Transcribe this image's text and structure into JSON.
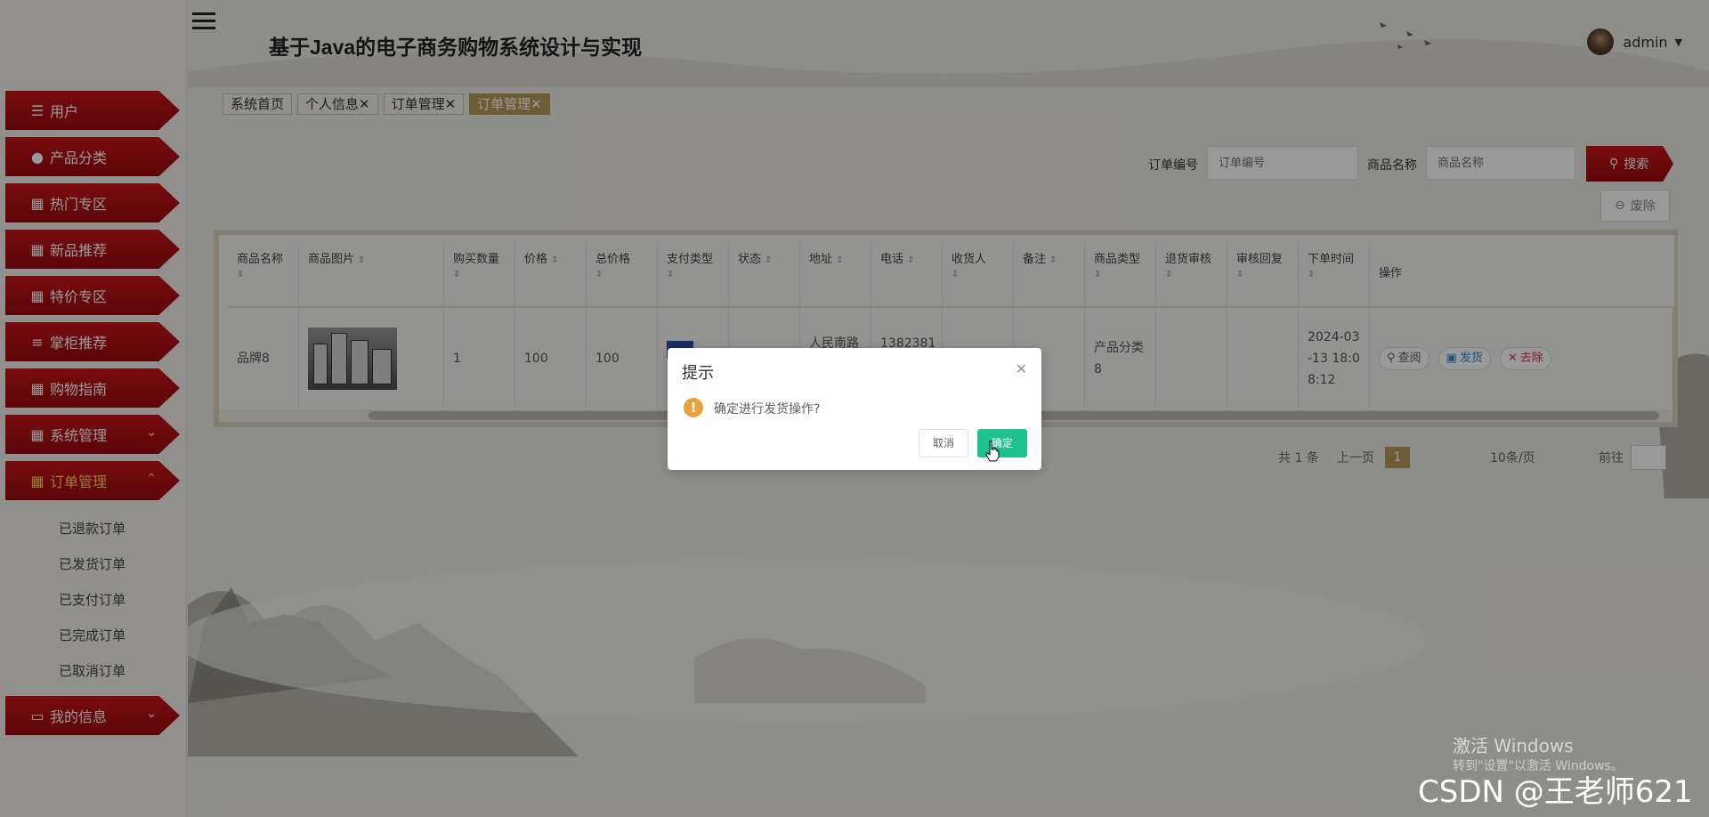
{
  "header": {
    "title": "基于Java的电子商务购物系统设计与实现",
    "user_name": "admin"
  },
  "sidebar": {
    "items": [
      {
        "label": "用户",
        "icon": "sliders-icon"
      },
      {
        "label": "产品分类",
        "icon": "person-icon"
      },
      {
        "label": "热门专区",
        "icon": "grid-icon"
      },
      {
        "label": "新品推荐",
        "icon": "grid-icon"
      },
      {
        "label": "特价专区",
        "icon": "grid-icon"
      },
      {
        "label": "掌柜推荐",
        "icon": "list-icon"
      },
      {
        "label": "购物指南",
        "icon": "grid-icon"
      },
      {
        "label": "系统管理",
        "icon": "grid-icon"
      },
      {
        "label": "订单管理",
        "icon": "grid-icon"
      },
      {
        "label": "我的信息",
        "icon": "card-icon"
      }
    ],
    "order_sub_items": [
      "已退款订单",
      "已发货订单",
      "已支付订单",
      "已完成订单",
      "已取消订单"
    ]
  },
  "tabs": [
    {
      "label": "系统首页"
    },
    {
      "label": "个人信息✕"
    },
    {
      "label": "订单管理✕"
    },
    {
      "label": "订单管理✕"
    }
  ],
  "search": {
    "order_no_label": "订单编号",
    "order_no_placeholder": "订单编号",
    "product_name_label": "商品名称",
    "product_name_placeholder": "商品名称",
    "search_button": "搜索",
    "delete_button": "废除"
  },
  "table": {
    "columns": [
      "商品名称",
      "商品图片",
      "购买数量",
      "价格",
      "总价格",
      "支付类型",
      "状态",
      "地址",
      "电话",
      "收货人",
      "备注",
      "商品类型",
      "退货审核",
      "审核回复",
      "下单时间",
      "操作"
    ],
    "row": {
      "product_name": "品牌8",
      "quantity": "1",
      "price": "100",
      "total": "100",
      "address": "人民南路",
      "phone": "1382381",
      "product_type": "产品分类8",
      "order_time": "2024-03-13 18:08:12",
      "op_view": "查阅",
      "op_ship": "发货",
      "op_remove": "去除"
    }
  },
  "pagination": {
    "total": "共 1 条",
    "prev": "上一页",
    "current": "1",
    "page_size": "10条/页",
    "goto": "前往"
  },
  "dialog": {
    "title": "提示",
    "message": "确定进行发货操作?",
    "cancel": "取消",
    "confirm": "确定"
  },
  "watermarks": {
    "activate_title": "激活 Windows",
    "activate_sub": "转到\"设置\"以激活 Windows。",
    "csdn": "CSDN @王老师621"
  },
  "colors": {
    "menu_red": "#b10f14",
    "accent_gold": "#b79a5b",
    "confirm_green": "#1ec28f",
    "warning": "#e6a23c"
  }
}
